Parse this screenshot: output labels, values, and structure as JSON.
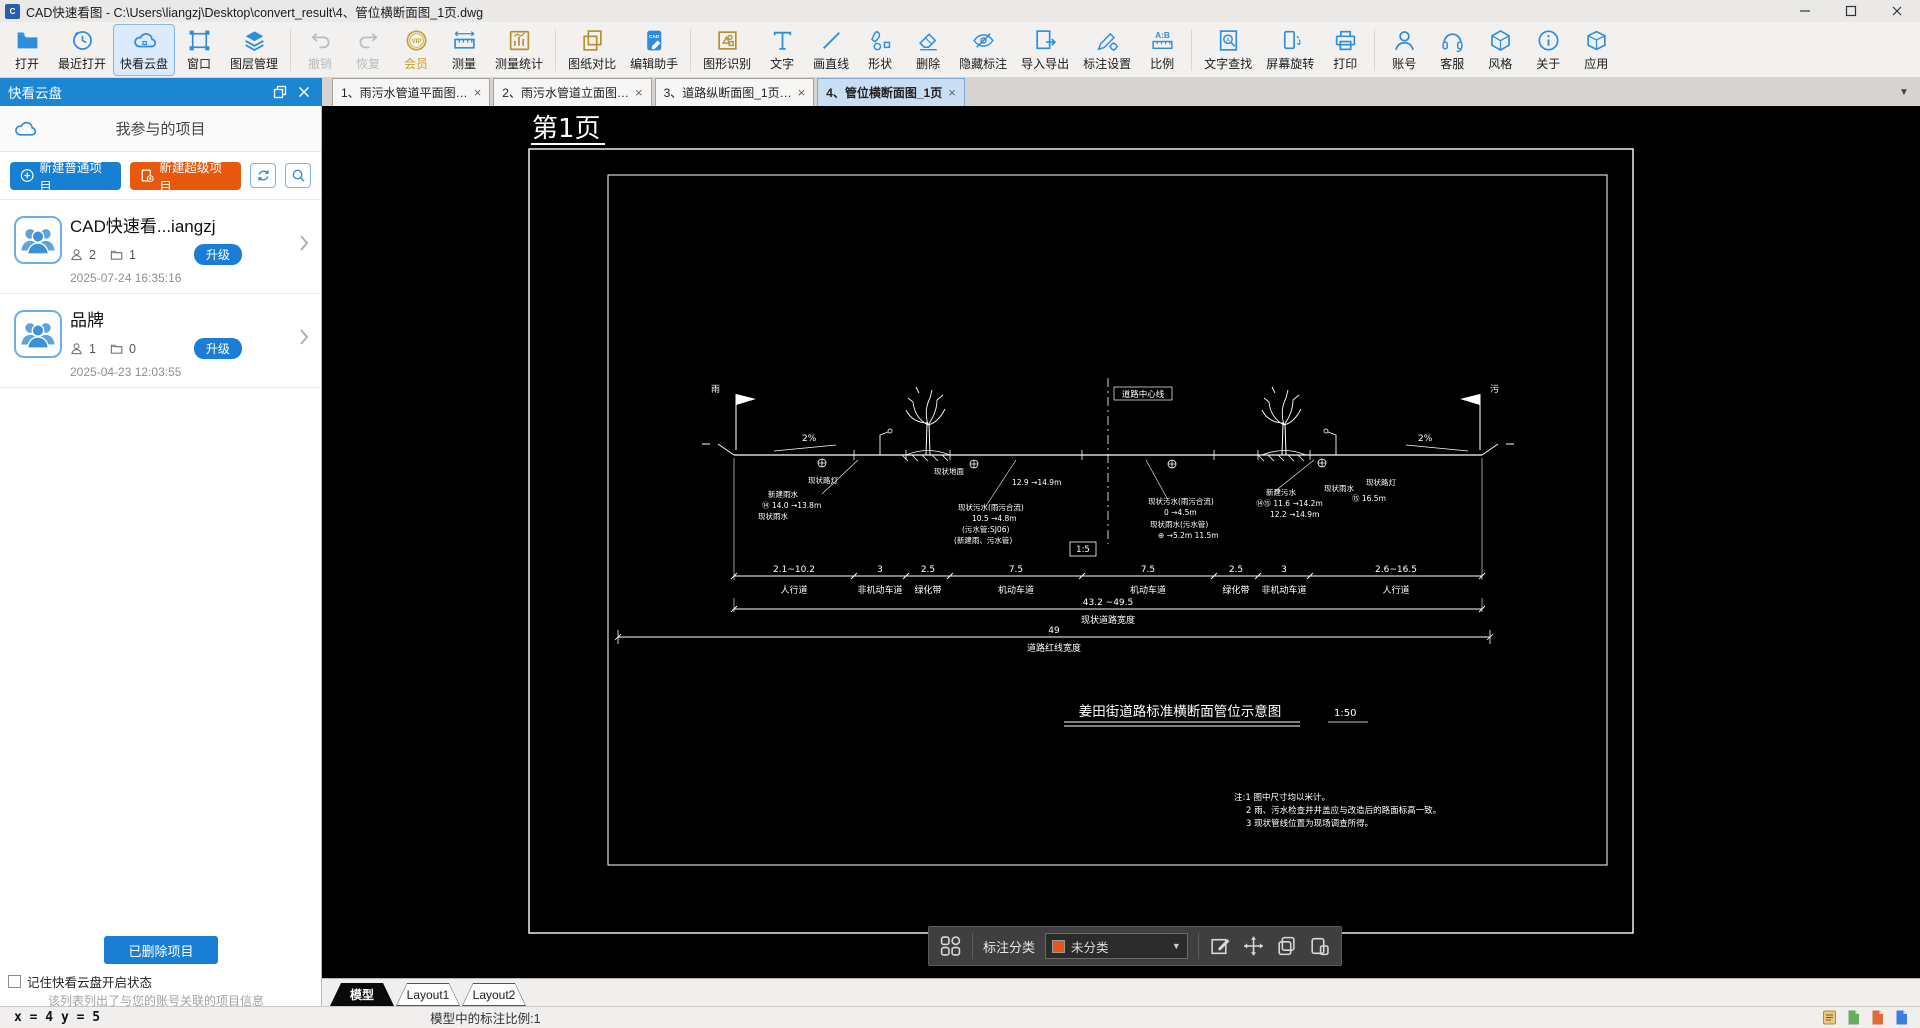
{
  "window": {
    "title": "CAD快速看图 - C:\\Users\\liangzj\\Desktop\\convert_result\\4、管位横断面图_1页.dwg"
  },
  "toolbar": {
    "items": [
      {
        "label": "打开"
      },
      {
        "label": "最近打开"
      },
      {
        "label": "快看云盘"
      },
      {
        "label": "窗口"
      },
      {
        "label": "图层管理"
      },
      {
        "label": "撤销"
      },
      {
        "label": "恢复"
      },
      {
        "label": "会员"
      },
      {
        "label": "测量"
      },
      {
        "label": "测量统计"
      },
      {
        "label": "图纸对比"
      },
      {
        "label": "编辑助手"
      },
      {
        "label": "图形识别"
      },
      {
        "label": "文字"
      },
      {
        "label": "画直线"
      },
      {
        "label": "形状"
      },
      {
        "label": "删除"
      },
      {
        "label": "隐藏标注"
      },
      {
        "label": "导入导出"
      },
      {
        "label": "标注设置"
      },
      {
        "label": "比例"
      },
      {
        "label": "文字查找"
      },
      {
        "label": "屏幕旋转"
      },
      {
        "label": "打印"
      },
      {
        "label": "账号"
      },
      {
        "label": "客服"
      },
      {
        "label": "风格"
      },
      {
        "label": "关于"
      },
      {
        "label": "应用"
      }
    ]
  },
  "panel": {
    "title": "快看云盘"
  },
  "tabs": {
    "items": [
      {
        "label": "1、雨污水管道平面图…"
      },
      {
        "label": "2、雨污水管道立面图…"
      },
      {
        "label": "3、道路纵断面图_1页…"
      },
      {
        "label": "4、管位横断面图_1页"
      }
    ]
  },
  "sidebar": {
    "section_title": "我参与的项目",
    "new_normal": "新建普通项目",
    "new_super": "新建超级项目",
    "projects": [
      {
        "name": "CAD快速看...iangzj",
        "members": "2",
        "files": "1",
        "upgrade": "升级",
        "date": "2025-07-24 16:35:16"
      },
      {
        "name": "品牌",
        "members": "1",
        "files": "0",
        "upgrade": "升级",
        "date": "2025-04-23 12:03:55"
      }
    ],
    "deleted_button": "已删除项目",
    "remember": "记住快看云盘开启状态",
    "hint": "该列表列出了与您的账号关联的项目信息"
  },
  "drawing": {
    "page_label": "第1页",
    "centerline": "道路中心线",
    "slope_left": "2%",
    "slope_right": "2%",
    "flag_left": "雨",
    "flag_right": "污",
    "pipe_box": "1:5",
    "dims": {
      "segments": [
        {
          "v": "2.1~10.2",
          "l": "人行道"
        },
        {
          "v": "3",
          "l": "非机动车道"
        },
        {
          "v": "2.5",
          "l": "绿化带"
        },
        {
          "v": "7.5",
          "l": "机动车道"
        },
        {
          "v": "7.5",
          "l": "机动车道"
        },
        {
          "v": "2.5",
          "l": "绿化带"
        },
        {
          "v": "3",
          "l": "非机动车道"
        },
        {
          "v": "2.6~16.5",
          "l": "人行道"
        }
      ],
      "total_value": "43.2 ~49.5",
      "total_label": "现状道路宽度",
      "redline_value": "49",
      "redline_label": "道路红线宽度"
    },
    "title": "姜田街道路标准横断面管位示意图",
    "title_scale": "1:50",
    "notes": [
      "注:1 图中尺寸均以米计。",
      "2 雨、污水检查井井盖应与改造后的路面标高一致。",
      "3 现状管线位置为现场调查所得。"
    ],
    "annotations": [
      {
        "t": "现状路灯"
      },
      {
        "t": "新建雨水"
      },
      {
        "t": "⑭ 14.0 →13.8m"
      },
      {
        "t": "现状雨水"
      },
      {
        "t": "现状地面"
      },
      {
        "t": "12.9 →14.9m"
      },
      {
        "t": "现状污水(雨污合流)"
      },
      {
        "t": "10.5 →4.8m"
      },
      {
        "t": "(污水管:SJ06)"
      },
      {
        "t": "(新建雨、污水管)"
      },
      {
        "t": "现状污水(雨污合流)"
      },
      {
        "t": "0 →4.5m"
      },
      {
        "t": "现状雨水(污水管)"
      },
      {
        "t": "⊕ →5.2m 11.5m"
      },
      {
        "t": "新建污水"
      },
      {
        "t": "⑭⑮ 11.6 →14.2m"
      },
      {
        "t": "12.2 →14.9m"
      },
      {
        "t": "现状雨水"
      },
      {
        "t": "⑮ 16.5m"
      },
      {
        "t": "现状路灯"
      }
    ]
  },
  "bottombar": {
    "category_label": "标注分类",
    "category_value": "未分类"
  },
  "layout_tabs": {
    "model": "模型",
    "layout1": "Layout1",
    "layout2": "Layout2"
  },
  "statusbar": {
    "coords": "x = 4 y = 5",
    "scale_text": "模型中的标注比例:1"
  }
}
